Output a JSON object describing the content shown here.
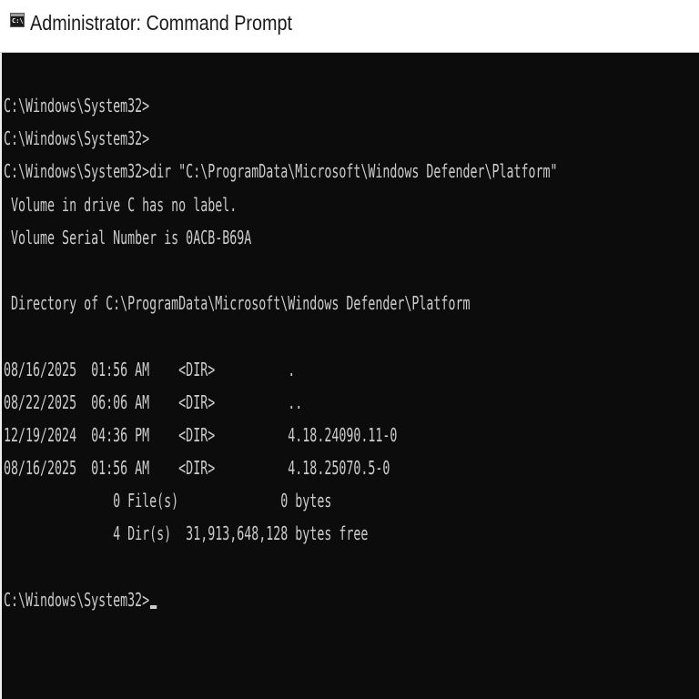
{
  "window": {
    "title": "Administrator: Command Prompt",
    "icon_text": "C:\\"
  },
  "console": {
    "lines": [
      "C:\\Windows\\System32>",
      "C:\\Windows\\System32>",
      "C:\\Windows\\System32>dir \"C:\\ProgramData\\Microsoft\\Windows Defender\\Platform\"",
      " Volume in drive C has no label.",
      " Volume Serial Number is 0ACB-B69A",
      "",
      " Directory of C:\\ProgramData\\Microsoft\\Windows Defender\\Platform",
      "",
      "08/16/2025  01:56 AM    <DIR>          .",
      "08/22/2025  06:06 AM    <DIR>          ..",
      "12/19/2024  04:36 PM    <DIR>          4.18.24090.11-0",
      "08/16/2025  01:56 AM    <DIR>          4.18.25070.5-0",
      "               0 File(s)              0 bytes",
      "               4 Dir(s)  31,913,648,128 bytes free",
      ""
    ],
    "prompt": "C:\\Windows\\System32>"
  },
  "colors": {
    "background": "#0c0c0c",
    "foreground": "#cccccc",
    "titlebar": "#ffffff"
  }
}
